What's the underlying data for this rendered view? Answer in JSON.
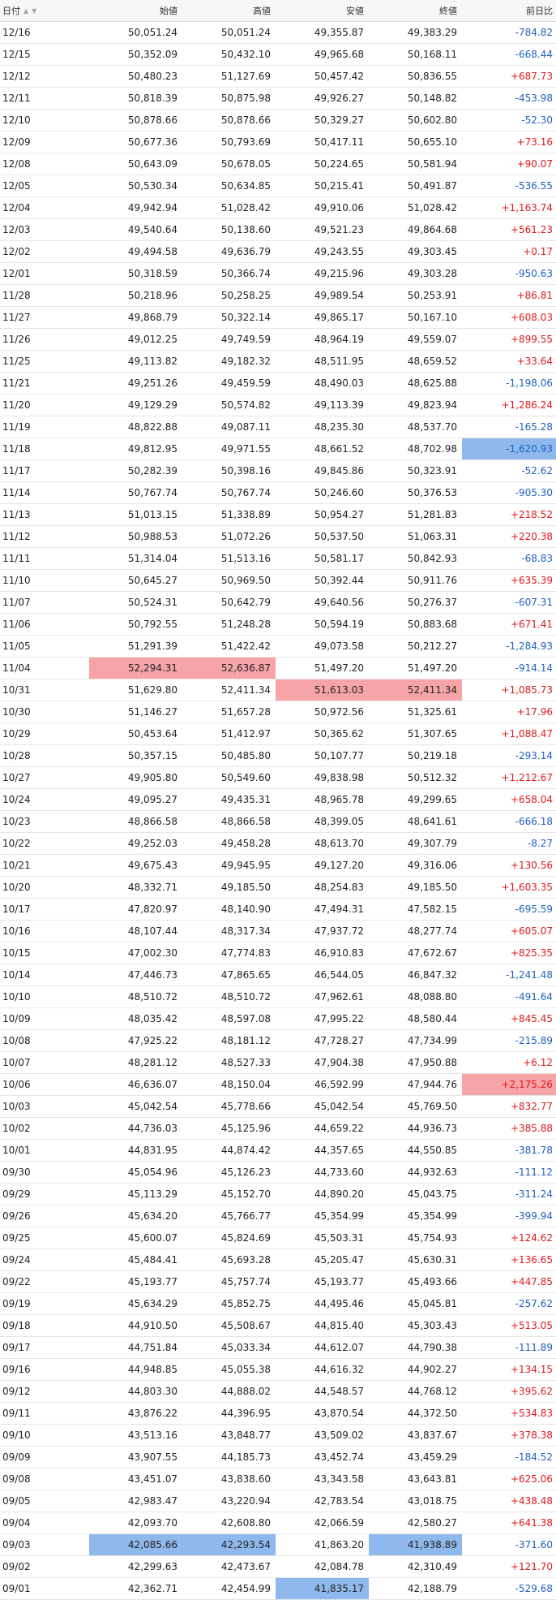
{
  "header": {
    "date": "日付",
    "sort_asc_icon": "▲",
    "sort_desc_icon": "▼",
    "open": "始値",
    "high": "高値",
    "low": "安値",
    "close": "終値",
    "change": "前日比"
  },
  "colors": {
    "positive": "#e0191b",
    "negative": "#1e5fbf",
    "highlight_red": "#f6a4a8",
    "highlight_blue": "#8fb8ec"
  },
  "rows": [
    [
      "12/16",
      "50,051.24",
      "50,051.24",
      "49,355.87",
      "49,383.29",
      "-784.82"
    ],
    [
      "12/15",
      "50,352.09",
      "50,432.10",
      "49,965.68",
      "50,168.11",
      "-668.44"
    ],
    [
      "12/12",
      "50,480.23",
      "51,127.69",
      "50,457.42",
      "50,836.55",
      "+687.73"
    ],
    [
      "12/11",
      "50,818.39",
      "50,875.98",
      "49,926.27",
      "50,148.82",
      "-453.98"
    ],
    [
      "12/10",
      "50,878.66",
      "50,878.66",
      "50,329.27",
      "50,602.80",
      "-52.30"
    ],
    [
      "12/09",
      "50,677.36",
      "50,793.69",
      "50,417.11",
      "50,655.10",
      "+73.16"
    ],
    [
      "12/08",
      "50,643.09",
      "50,678.05",
      "50,224.65",
      "50,581.94",
      "+90.07"
    ],
    [
      "12/05",
      "50,530.34",
      "50,634.85",
      "50,215.41",
      "50,491.87",
      "-536.55"
    ],
    [
      "12/04",
      "49,942.94",
      "51,028.42",
      "49,910.06",
      "51,028.42",
      "+1,163.74"
    ],
    [
      "12/03",
      "49,540.64",
      "50,138.60",
      "49,521.23",
      "49,864.68",
      "+561.23"
    ],
    [
      "12/02",
      "49,494.58",
      "49,636.79",
      "49,243.55",
      "49,303.45",
      "+0.17"
    ],
    [
      "12/01",
      "50,318.59",
      "50,366.74",
      "49,215.96",
      "49,303.28",
      "-950.63"
    ],
    [
      "11/28",
      "50,218.96",
      "50,258.25",
      "49,989.54",
      "50,253.91",
      "+86.81"
    ],
    [
      "11/27",
      "49,868.79",
      "50,322.14",
      "49,865.17",
      "50,167.10",
      "+608.03"
    ],
    [
      "11/26",
      "49,012.25",
      "49,749.59",
      "48,964.19",
      "49,559.07",
      "+899.55"
    ],
    [
      "11/25",
      "49,113.82",
      "49,182.32",
      "48,511.95",
      "48,659.52",
      "+33.64"
    ],
    [
      "11/21",
      "49,251.26",
      "49,459.59",
      "48,490.03",
      "48,625.88",
      "-1,198.06"
    ],
    [
      "11/20",
      "49,129.29",
      "50,574.82",
      "49,113.39",
      "49,823.94",
      "+1,286.24"
    ],
    [
      "11/19",
      "48,822.88",
      "49,087.11",
      "48,235.30",
      "48,537.70",
      "-165.28"
    ],
    [
      "11/18",
      "49,812.95",
      "49,971.55",
      "48,661.52",
      "48,702.98",
      "-1,620.93"
    ],
    [
      "11/17",
      "50,282.39",
      "50,398.16",
      "49,845.86",
      "50,323.91",
      "-52.62"
    ],
    [
      "11/14",
      "50,767.74",
      "50,767.74",
      "50,246.60",
      "50,376.53",
      "-905.30"
    ],
    [
      "11/13",
      "51,013.15",
      "51,338.89",
      "50,954.27",
      "51,281.83",
      "+218.52"
    ],
    [
      "11/12",
      "50,988.53",
      "51,072.26",
      "50,537.50",
      "51,063.31",
      "+220.38"
    ],
    [
      "11/11",
      "51,314.04",
      "51,513.16",
      "50,581.17",
      "50,842.93",
      "-68.83"
    ],
    [
      "11/10",
      "50,645.27",
      "50,969.50",
      "50,392.44",
      "50,911.76",
      "+635.39"
    ],
    [
      "11/07",
      "50,524.31",
      "50,642.79",
      "49,640.56",
      "50,276.37",
      "-607.31"
    ],
    [
      "11/06",
      "50,792.55",
      "51,248.28",
      "50,594.19",
      "50,883.68",
      "+671.41"
    ],
    [
      "11/05",
      "51,291.39",
      "51,422.42",
      "49,073.58",
      "50,212.27",
      "-1,284.93"
    ],
    [
      "11/04",
      "52,294.31",
      "52,636.87",
      "51,497.20",
      "51,497.20",
      "-914.14"
    ],
    [
      "10/31",
      "51,629.80",
      "52,411.34",
      "51,613.03",
      "52,411.34",
      "+1,085.73"
    ],
    [
      "10/30",
      "51,146.27",
      "51,657.28",
      "50,972.56",
      "51,325.61",
      "+17.96"
    ],
    [
      "10/29",
      "50,453.64",
      "51,412.97",
      "50,365.62",
      "51,307.65",
      "+1,088.47"
    ],
    [
      "10/28",
      "50,357.15",
      "50,485.80",
      "50,107.77",
      "50,219.18",
      "-293.14"
    ],
    [
      "10/27",
      "49,905.80",
      "50,549.60",
      "49,838.98",
      "50,512.32",
      "+1,212.67"
    ],
    [
      "10/24",
      "49,095.27",
      "49,435.31",
      "48,965.78",
      "49,299.65",
      "+658.04"
    ],
    [
      "10/23",
      "48,866.58",
      "48,866.58",
      "48,399.05",
      "48,641.61",
      "-666.18"
    ],
    [
      "10/22",
      "49,252.03",
      "49,458.28",
      "48,613.70",
      "49,307.79",
      "-8.27"
    ],
    [
      "10/21",
      "49,675.43",
      "49,945.95",
      "49,127.20",
      "49,316.06",
      "+130.56"
    ],
    [
      "10/20",
      "48,332.71",
      "49,185.50",
      "48,254.83",
      "49,185.50",
      "+1,603.35"
    ],
    [
      "10/17",
      "47,820.97",
      "48,140.90",
      "47,494.31",
      "47,582.15",
      "-695.59"
    ],
    [
      "10/16",
      "48,107.44",
      "48,317.34",
      "47,937.72",
      "48,277.74",
      "+605.07"
    ],
    [
      "10/15",
      "47,002.30",
      "47,774.83",
      "46,910.83",
      "47,672.67",
      "+825.35"
    ],
    [
      "10/14",
      "47,446.73",
      "47,865.65",
      "46,544.05",
      "46,847.32",
      "-1,241.48"
    ],
    [
      "10/10",
      "48,510.72",
      "48,510.72",
      "47,962.61",
      "48,088.80",
      "-491.64"
    ],
    [
      "10/09",
      "48,035.42",
      "48,597.08",
      "47,995.22",
      "48,580.44",
      "+845.45"
    ],
    [
      "10/08",
      "47,925.22",
      "48,181.12",
      "47,728.27",
      "47,734.99",
      "-215.89"
    ],
    [
      "10/07",
      "48,281.12",
      "48,527.33",
      "47,904.38",
      "47,950.88",
      "+6.12"
    ],
    [
      "10/06",
      "46,636.07",
      "48,150.04",
      "46,592.99",
      "47,944.76",
      "+2,175.26"
    ],
    [
      "10/03",
      "45,042.54",
      "45,778.66",
      "45,042.54",
      "45,769.50",
      "+832.77"
    ],
    [
      "10/02",
      "44,736.03",
      "45,125.96",
      "44,659.22",
      "44,936.73",
      "+385.88"
    ],
    [
      "10/01",
      "44,831.95",
      "44,874.42",
      "44,357.65",
      "44,550.85",
      "-381.78"
    ],
    [
      "09/30",
      "45,054.96",
      "45,126.23",
      "44,733.60",
      "44,932.63",
      "-111.12"
    ],
    [
      "09/29",
      "45,113.29",
      "45,152.70",
      "44,890.20",
      "45,043.75",
      "-311.24"
    ],
    [
      "09/26",
      "45,634.20",
      "45,766.77",
      "45,354.99",
      "45,354.99",
      "-399.94"
    ],
    [
      "09/25",
      "45,600.07",
      "45,824.69",
      "45,503.31",
      "45,754.93",
      "+124.62"
    ],
    [
      "09/24",
      "45,484.41",
      "45,693.28",
      "45,205.47",
      "45,630.31",
      "+136.65"
    ],
    [
      "09/22",
      "45,193.77",
      "45,757.74",
      "45,193.77",
      "45,493.66",
      "+447.85"
    ],
    [
      "09/19",
      "45,634.29",
      "45,852.75",
      "44,495.46",
      "45,045.81",
      "-257.62"
    ],
    [
      "09/18",
      "44,910.50",
      "45,508.67",
      "44,815.40",
      "45,303.43",
      "+513.05"
    ],
    [
      "09/17",
      "44,751.84",
      "45,033.34",
      "44,612.07",
      "44,790.38",
      "-111.89"
    ],
    [
      "09/16",
      "44,948.85",
      "45,055.38",
      "44,616.32",
      "44,902.27",
      "+134.15"
    ],
    [
      "09/12",
      "44,803.30",
      "44,888.02",
      "44,548.57",
      "44,768.12",
      "+395.62"
    ],
    [
      "09/11",
      "43,876.22",
      "44,396.95",
      "43,870.54",
      "44,372.50",
      "+534.83"
    ],
    [
      "09/10",
      "43,513.16",
      "43,848.77",
      "43,509.02",
      "43,837.67",
      "+378.38"
    ],
    [
      "09/09",
      "43,907.55",
      "44,185.73",
      "43,452.74",
      "43,459.29",
      "-184.52"
    ],
    [
      "09/08",
      "43,451.07",
      "43,838.60",
      "43,343.58",
      "43,643.81",
      "+625.06"
    ],
    [
      "09/05",
      "42,983.47",
      "43,220.94",
      "42,783.54",
      "43,018.75",
      "+438.48"
    ],
    [
      "09/04",
      "42,093.70",
      "42,608.80",
      "42,066.59",
      "42,580.27",
      "+641.38"
    ],
    [
      "09/03",
      "42,085.66",
      "42,293.54",
      "41,863.20",
      "41,938.89",
      "-371.60"
    ],
    [
      "09/02",
      "42,299.63",
      "42,473.67",
      "42,084.78",
      "42,310.49",
      "+121.70"
    ],
    [
      "09/01",
      "42,362.71",
      "42,454.99",
      "41,835.17",
      "42,188.79",
      "-529.68"
    ]
  ],
  "highlights": [
    {
      "date": "11/18",
      "column": "change",
      "color": "blue"
    },
    {
      "date": "11/04",
      "column": "open",
      "color": "red"
    },
    {
      "date": "11/04",
      "column": "high",
      "color": "red"
    },
    {
      "date": "10/31",
      "column": "low",
      "color": "red"
    },
    {
      "date": "10/31",
      "column": "close",
      "color": "red"
    },
    {
      "date": "10/06",
      "column": "change",
      "color": "red"
    },
    {
      "date": "09/03",
      "column": "open",
      "color": "blue"
    },
    {
      "date": "09/03",
      "column": "high",
      "color": "blue"
    },
    {
      "date": "09/03",
      "column": "close",
      "color": "blue"
    },
    {
      "date": "09/01",
      "column": "low",
      "color": "blue"
    }
  ]
}
